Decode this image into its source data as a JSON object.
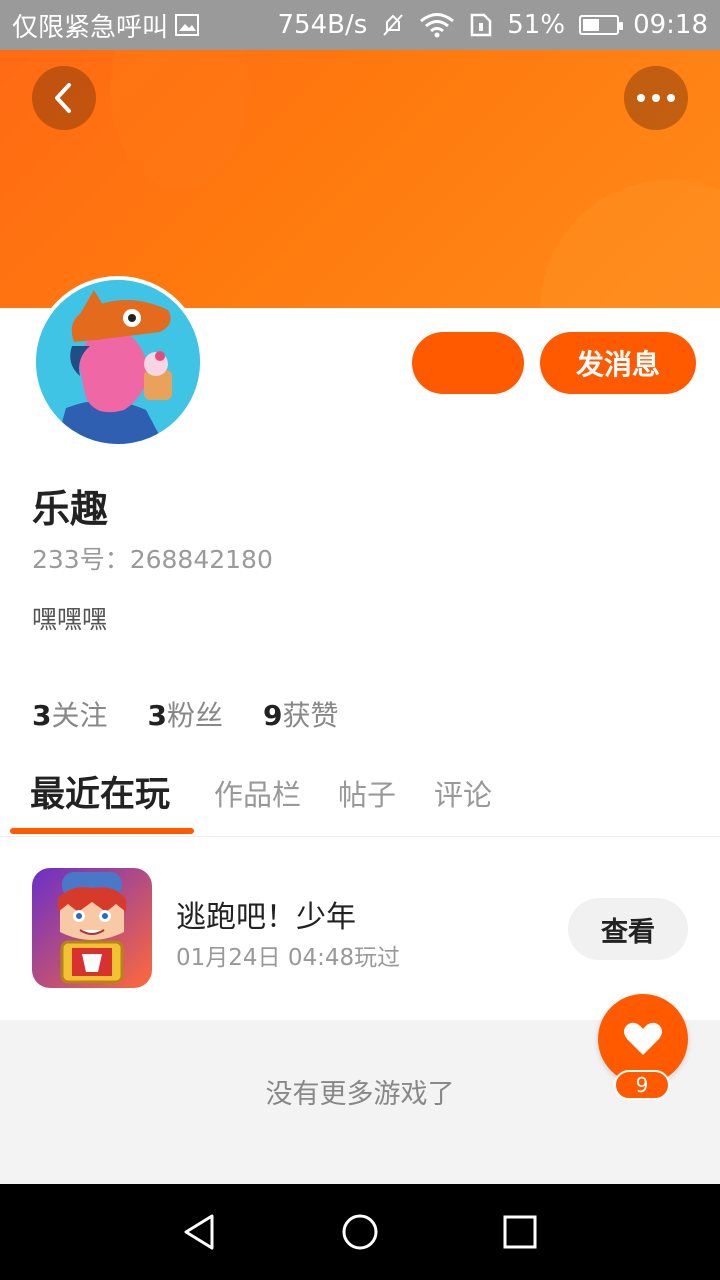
{
  "status_bar": {
    "carrier_text": "仅限紧急呼叫",
    "net_speed": "754B/s",
    "battery_pct": "51%",
    "battery_level": 0.51,
    "time": "09:18",
    "icons": [
      "image-icon",
      "mute-icon",
      "wifi-icon",
      "sim-icon",
      "battery-icon"
    ]
  },
  "header": {
    "back_icon": "chevron-left-icon",
    "more_icon": "more-dots-icon",
    "banner_color": "#ff7a0e"
  },
  "profile": {
    "name": "乐趣",
    "id_label": "233号：268842180",
    "bio": "嘿嘿嘿",
    "follow_button_label": "",
    "message_button_label": "发消息",
    "stats": [
      {
        "count": "3",
        "label": "关注"
      },
      {
        "count": "3",
        "label": "粉丝"
      },
      {
        "count": "9",
        "label": "获赞"
      }
    ]
  },
  "tabs": [
    {
      "label": "最近在玩",
      "active": true
    },
    {
      "label": "作品栏",
      "active": false
    },
    {
      "label": "帖子",
      "active": false
    },
    {
      "label": "评论",
      "active": false
    }
  ],
  "games": [
    {
      "title": "逃跑吧！少年",
      "played_at": "01月24日 04:48玩过",
      "action_label": "查看"
    }
  ],
  "empty_text": "没有更多游戏了",
  "like": {
    "count": "9",
    "icon": "heart-icon"
  },
  "nav": {
    "icons": [
      "back-triangle-icon",
      "home-circle-icon",
      "recent-square-icon"
    ]
  },
  "colors": {
    "accent": "#ff5a00",
    "background_gray": "#f3f3f3"
  }
}
